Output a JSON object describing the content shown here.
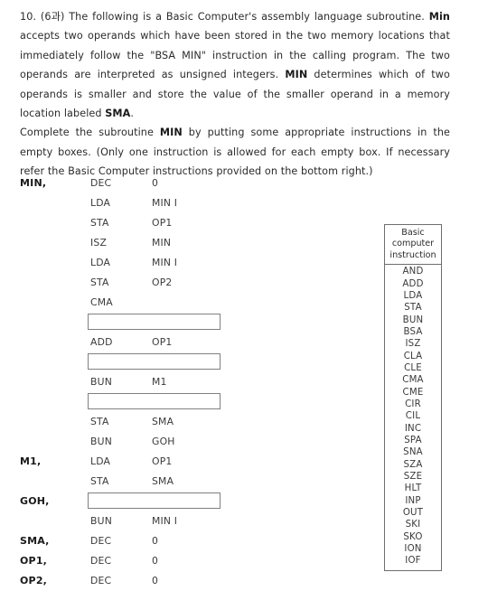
{
  "question": {
    "number": "10.",
    "chapter": "(6과)",
    "paragraph1_parts": [
      {
        "text": "10. (6과) The following is a Basic Computer's assembly language subroutine. ",
        "bold": false
      },
      {
        "text": "Min",
        "bold": true
      },
      {
        "text": " accepts two operands which have been stored in the two memory locations that immediately follow the \"BSA MIN\" instruction in the calling program. The two operands are interpreted as unsigned integers. ",
        "bold": false
      },
      {
        "text": "MIN",
        "bold": true
      },
      {
        "text": " determines which of two operands is smaller and store the value of the smaller operand in a memory location labeled ",
        "bold": false
      },
      {
        "text": "SMA",
        "bold": true
      },
      {
        "text": ".",
        "bold": false
      }
    ],
    "paragraph2_parts": [
      {
        "text": "Complete the subroutine ",
        "bold": false
      },
      {
        "text": "MIN",
        "bold": true
      },
      {
        "text": " by putting some appropriate instructions in the empty boxes. (Only one instruction is allowed for each empty box. If necessary refer the Basic Computer instructions provided on the bottom right.)",
        "bold": false
      }
    ]
  },
  "code_listing": {
    "rows": [
      {
        "label": "MIN,",
        "mnemonic": "DEC",
        "operand": "0",
        "box": false
      },
      {
        "label": "",
        "mnemonic": "LDA",
        "operand": "MIN I",
        "box": false
      },
      {
        "label": "",
        "mnemonic": "STA",
        "operand": "OP1",
        "box": false
      },
      {
        "label": "",
        "mnemonic": "ISZ",
        "operand": "MIN",
        "box": false
      },
      {
        "label": "",
        "mnemonic": "LDA",
        "operand": "MIN I",
        "box": false
      },
      {
        "label": "",
        "mnemonic": "STA",
        "operand": "OP2",
        "box": false
      },
      {
        "label": "",
        "mnemonic": "CMA",
        "operand": "",
        "box": false
      },
      {
        "label": "",
        "mnemonic": "",
        "operand": "",
        "box": true
      },
      {
        "label": "",
        "mnemonic": "ADD",
        "operand": "OP1",
        "box": false
      },
      {
        "label": "",
        "mnemonic": "",
        "operand": "",
        "box": true
      },
      {
        "label": "",
        "mnemonic": "BUN",
        "operand": "M1",
        "box": false
      },
      {
        "label": "",
        "mnemonic": "",
        "operand": "",
        "box": true
      },
      {
        "label": "",
        "mnemonic": "STA",
        "operand": "SMA",
        "box": false
      },
      {
        "label": "",
        "mnemonic": "BUN",
        "operand": "GOH",
        "box": false
      },
      {
        "label": "M1,",
        "mnemonic": "LDA",
        "operand": "OP1",
        "box": false
      },
      {
        "label": "",
        "mnemonic": "STA",
        "operand": "SMA",
        "box": false
      },
      {
        "label": "GOH,",
        "mnemonic": "",
        "operand": "",
        "box": true
      },
      {
        "label": "",
        "mnemonic": "BUN",
        "operand": "MIN I",
        "box": false
      },
      {
        "label": "SMA,",
        "mnemonic": "DEC",
        "operand": "0",
        "box": false
      },
      {
        "label": "OP1,",
        "mnemonic": "DEC",
        "operand": "0",
        "box": false
      },
      {
        "label": "OP2,",
        "mnemonic": "DEC",
        "operand": "0",
        "box": false
      }
    ]
  },
  "instruction_table": {
    "header": "Basic computer instruction",
    "header_lines": [
      "Basic",
      "computer",
      "instruction"
    ],
    "items": [
      "AND",
      "ADD",
      "LDA",
      "STA",
      "BUN",
      "BSA",
      "ISZ",
      "CLA",
      "CLE",
      "CMA",
      "CME",
      "CIR",
      "CIL",
      "INC",
      "SPA",
      "SNA",
      "SZA",
      "SZE",
      "HLT",
      "INP",
      "OUT",
      "SKI",
      "SKO",
      "ION",
      "IOF"
    ]
  },
  "colors": {
    "text": "#2b2b2b",
    "box_border": "#808080",
    "table_border": "#6e6e6e",
    "background": "#ffffff"
  }
}
